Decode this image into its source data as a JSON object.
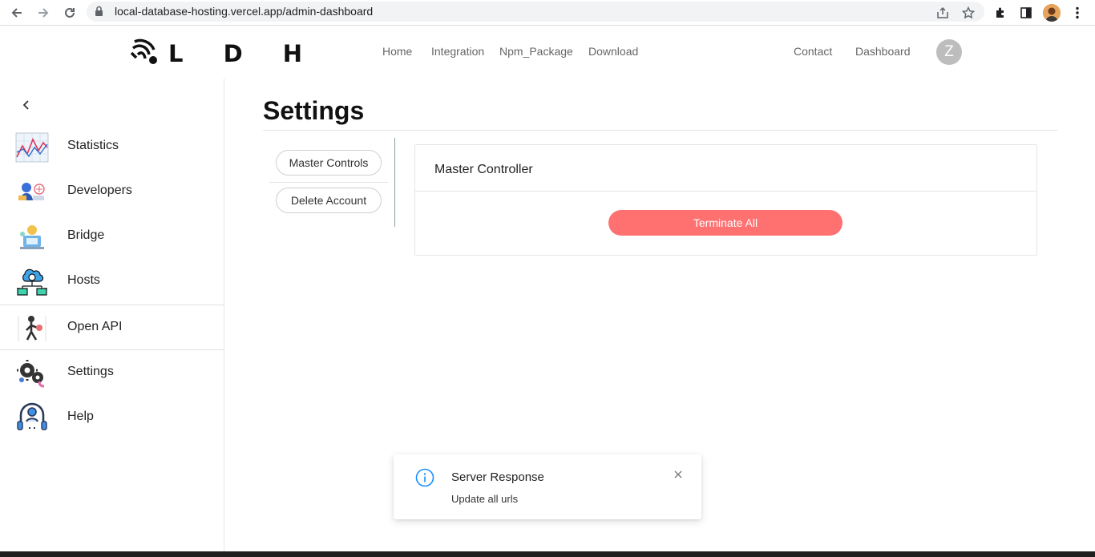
{
  "browser": {
    "url": "local-database-hosting.vercel.app/admin-dashboard"
  },
  "header": {
    "logo_text": "L D H",
    "nav": [
      "Home",
      "Integration",
      "Npm_Package",
      "Download"
    ],
    "right_nav": [
      "Contact",
      "Dashboard"
    ],
    "avatar_letter": "Z"
  },
  "sidebar": {
    "items": [
      {
        "label": "Statistics",
        "icon": "statistics-chart-icon"
      },
      {
        "label": "Developers",
        "icon": "developers-icon"
      },
      {
        "label": "Bridge",
        "icon": "bridge-icon"
      },
      {
        "label": "Hosts",
        "icon": "hosts-network-icon"
      },
      {
        "label": "Open API",
        "icon": "open-api-icon"
      },
      {
        "label": "Settings",
        "icon": "settings-gears-icon"
      },
      {
        "label": "Help",
        "icon": "help-headset-icon"
      }
    ]
  },
  "main": {
    "title": "Settings",
    "settings_nav": [
      "Master Controls",
      "Delete Account"
    ],
    "card": {
      "title": "Master Controller",
      "button_label": "Terminate All"
    }
  },
  "notification": {
    "title": "Server Response",
    "message": "Update all urls",
    "close_label": "X"
  },
  "colors": {
    "terminate": "#ff7070",
    "info": "#1890ff",
    "avatar": "#bdbdbd"
  }
}
